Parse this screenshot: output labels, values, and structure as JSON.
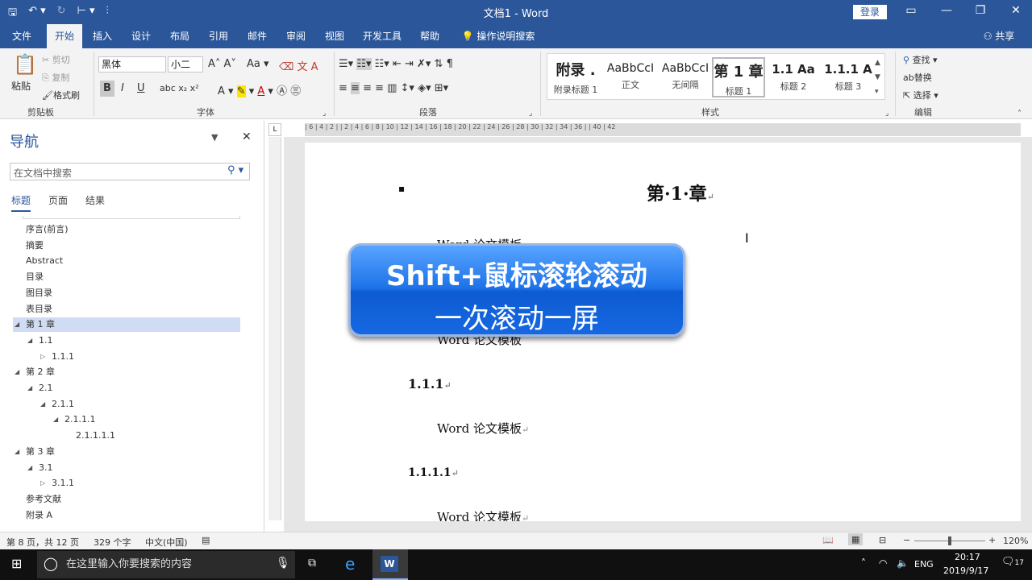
{
  "window": {
    "title": "文档1  -  Word",
    "login": "登录"
  },
  "tabs": [
    "文件",
    "开始",
    "插入",
    "设计",
    "布局",
    "引用",
    "邮件",
    "审阅",
    "视图",
    "开发工具",
    "帮助",
    "操作说明搜索",
    "共享"
  ],
  "ribbon": {
    "clipboard": {
      "paste": "粘贴",
      "cut": "剪切",
      "copy": "复制",
      "format_painter": "格式刷",
      "label": "剪贴板"
    },
    "font": {
      "name": "黑体",
      "size": "小二",
      "label": "字体",
      "bold": "B",
      "italic": "I",
      "underline": "U"
    },
    "paragraph": {
      "label": "段落"
    },
    "styles": {
      "label": "样式",
      "items": [
        {
          "preview": "附录 .",
          "name": "附录标题 1"
        },
        {
          "preview": "AaBbCcI",
          "name": "正文"
        },
        {
          "preview": "AaBbCcI",
          "name": "无间隔"
        },
        {
          "preview": "第 1 章",
          "name": "标题 1"
        },
        {
          "preview": "1.1  Aa",
          "name": "标题 2"
        },
        {
          "preview": "1.1.1  A",
          "name": "标题 3"
        }
      ]
    },
    "editing": {
      "find": "查找",
      "replace": "替换",
      "select": "选择",
      "label": "编辑"
    }
  },
  "nav": {
    "title": "导航",
    "search_placeholder": "在文档中搜索",
    "tabs": [
      "标题",
      "页面",
      "结果"
    ],
    "items": [
      {
        "label": "序言(前言)",
        "level": 0,
        "arrow": ""
      },
      {
        "label": "摘要",
        "level": 0,
        "arrow": ""
      },
      {
        "label": "Abstract",
        "level": 0,
        "arrow": ""
      },
      {
        "label": "目录",
        "level": 0,
        "arrow": ""
      },
      {
        "label": "图目录",
        "level": 0,
        "arrow": ""
      },
      {
        "label": "表目录",
        "level": 0,
        "arrow": ""
      },
      {
        "label": "第 1 章",
        "level": 0,
        "arrow": "◢",
        "selected": true
      },
      {
        "label": "1.1",
        "level": 1,
        "arrow": "◢"
      },
      {
        "label": "1.1.1",
        "level": 2,
        "arrow": "▷"
      },
      {
        "label": "第 2 章",
        "level": 0,
        "arrow": "◢"
      },
      {
        "label": "2.1",
        "level": 1,
        "arrow": "◢"
      },
      {
        "label": "2.1.1",
        "level": 2,
        "arrow": "◢"
      },
      {
        "label": "2.1.1.1",
        "level": 3,
        "arrow": "◢"
      },
      {
        "label": "2.1.1.1.1",
        "level": 4,
        "arrow": ""
      },
      {
        "label": "第 3 章",
        "level": 0,
        "arrow": "◢"
      },
      {
        "label": "3.1",
        "level": 1,
        "arrow": "◢"
      },
      {
        "label": "3.1.1",
        "level": 2,
        "arrow": "▷"
      },
      {
        "label": "参考文献",
        "level": 0,
        "arrow": ""
      },
      {
        "label": "附录 A",
        "level": 0,
        "arrow": ""
      }
    ]
  },
  "ruler": {
    "ticks": "| 6 | 4 | 2 |   | 2 | 4 | 6 | 8 | 10 | 12 | 14 | 16 | 18 | 20 | 22 | 24 | 26 | 28 | 30 | 32 | 34 | 36 |   | 40 | 42"
  },
  "document": {
    "chapter": "第·1·章",
    "chapter_mark": "↵",
    "partial_top": "Word 论文模板",
    "partial_mid": "Word 论文模板",
    "heading_111": "1.1.1",
    "body_1": "Word 论文模板",
    "heading_1111": "1.1.1.1",
    "body_2": "Word 论文模板",
    "bullet": "▪"
  },
  "banner": {
    "line1": "Shift+鼠标滚轮滚动",
    "line2": "一次滚动一屏"
  },
  "status": {
    "page": "第 8 页，共 12 页",
    "words": "329 个字",
    "lang": "中文(中国)",
    "zoom": "120%"
  },
  "taskbar": {
    "search": "在这里输入你要搜索的内容",
    "lang": "ENG",
    "time": "20:17",
    "date": "2019/9/17",
    "notif": "17"
  }
}
